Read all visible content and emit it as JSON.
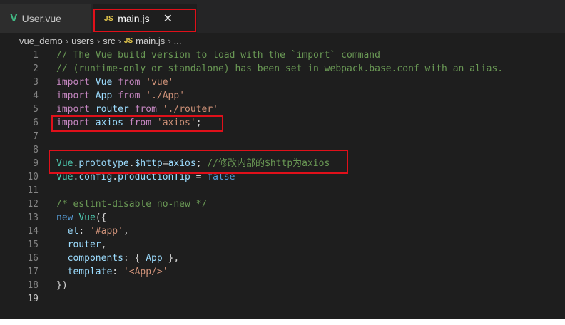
{
  "tabs": [
    {
      "icon": "V",
      "label": "User.vue"
    },
    {
      "icon": "JS",
      "label": "main.js",
      "close": "✕"
    }
  ],
  "breadcrumb": {
    "parts": [
      "vue_demo",
      "users",
      "src"
    ],
    "file_icon": "JS",
    "file": "main.js",
    "more": "...",
    "separator": "›"
  },
  "code": {
    "active_line": "19",
    "lines": [
      {
        "n": "1",
        "tokens": [
          {
            "t": "// The Vue build version to load with the `import` command",
            "c": "comment"
          }
        ]
      },
      {
        "n": "2",
        "tokens": [
          {
            "t": "// (runtime-only or standalone) has been set in webpack.base.conf with an alias.",
            "c": "comment"
          }
        ]
      },
      {
        "n": "3",
        "tokens": [
          {
            "t": "import ",
            "c": "keyword"
          },
          {
            "t": "Vue ",
            "c": "var"
          },
          {
            "t": "from ",
            "c": "keyword"
          },
          {
            "t": "'vue'",
            "c": "string"
          }
        ]
      },
      {
        "n": "4",
        "tokens": [
          {
            "t": "import ",
            "c": "keyword"
          },
          {
            "t": "App ",
            "c": "var"
          },
          {
            "t": "from ",
            "c": "keyword"
          },
          {
            "t": "'./App'",
            "c": "string"
          }
        ]
      },
      {
        "n": "5",
        "tokens": [
          {
            "t": "import ",
            "c": "keyword"
          },
          {
            "t": "router ",
            "c": "var"
          },
          {
            "t": "from ",
            "c": "keyword"
          },
          {
            "t": "'./router'",
            "c": "string"
          }
        ]
      },
      {
        "n": "6",
        "tokens": [
          {
            "t": "import ",
            "c": "keyword"
          },
          {
            "t": "axios ",
            "c": "var"
          },
          {
            "t": "from ",
            "c": "keyword"
          },
          {
            "t": "'axios'",
            "c": "string"
          },
          {
            "t": ";",
            "c": "plain"
          }
        ]
      },
      {
        "n": "7",
        "tokens": []
      },
      {
        "n": "8",
        "tokens": []
      },
      {
        "n": "9",
        "tokens": [
          {
            "t": "Vue",
            "c": "class"
          },
          {
            "t": ".",
            "c": "plain"
          },
          {
            "t": "prototype",
            "c": "var"
          },
          {
            "t": ".",
            "c": "plain"
          },
          {
            "t": "$http",
            "c": "var"
          },
          {
            "t": "=",
            "c": "plain"
          },
          {
            "t": "axios",
            "c": "var"
          },
          {
            "t": "; ",
            "c": "plain"
          },
          {
            "t": "//修改内部的$http为axios",
            "c": "comment"
          }
        ]
      },
      {
        "n": "10",
        "tokens": [
          {
            "t": "Vue",
            "c": "class"
          },
          {
            "t": ".",
            "c": "plain"
          },
          {
            "t": "config",
            "c": "var"
          },
          {
            "t": ".",
            "c": "plain"
          },
          {
            "t": "productionTip",
            "c": "var"
          },
          {
            "t": " = ",
            "c": "plain"
          },
          {
            "t": "false",
            "c": "bool"
          }
        ]
      },
      {
        "n": "11",
        "tokens": []
      },
      {
        "n": "12",
        "tokens": [
          {
            "t": "/* eslint-disable no-new */",
            "c": "comment"
          }
        ]
      },
      {
        "n": "13",
        "tokens": [
          {
            "t": "new ",
            "c": "bool"
          },
          {
            "t": "Vue",
            "c": "class"
          },
          {
            "t": "({",
            "c": "plain"
          }
        ]
      },
      {
        "n": "14",
        "tokens": [
          {
            "t": "  el",
            "c": "var"
          },
          {
            "t": ": ",
            "c": "plain"
          },
          {
            "t": "'#app'",
            "c": "string"
          },
          {
            "t": ",",
            "c": "plain"
          }
        ]
      },
      {
        "n": "15",
        "tokens": [
          {
            "t": "  router",
            "c": "var"
          },
          {
            "t": ",",
            "c": "plain"
          }
        ]
      },
      {
        "n": "16",
        "tokens": [
          {
            "t": "  components",
            "c": "var"
          },
          {
            "t": ": { ",
            "c": "plain"
          },
          {
            "t": "App",
            "c": "var"
          },
          {
            "t": " },",
            "c": "plain"
          }
        ]
      },
      {
        "n": "17",
        "tokens": [
          {
            "t": "  template",
            "c": "var"
          },
          {
            "t": ": ",
            "c": "plain"
          },
          {
            "t": "'<App/>'",
            "c": "string"
          }
        ]
      },
      {
        "n": "18",
        "tokens": [
          {
            "t": "})",
            "c": "plain"
          }
        ]
      },
      {
        "n": "19",
        "tokens": []
      }
    ]
  },
  "colors": {
    "editor_bg": "#1e1e1e",
    "tabbar_bg": "#252526",
    "highlight_box": "#e0101a",
    "comment": "#6a9955",
    "keyword": "#c586c0",
    "string": "#ce9178",
    "variable": "#9cdcfe",
    "class": "#4ec9b0"
  }
}
